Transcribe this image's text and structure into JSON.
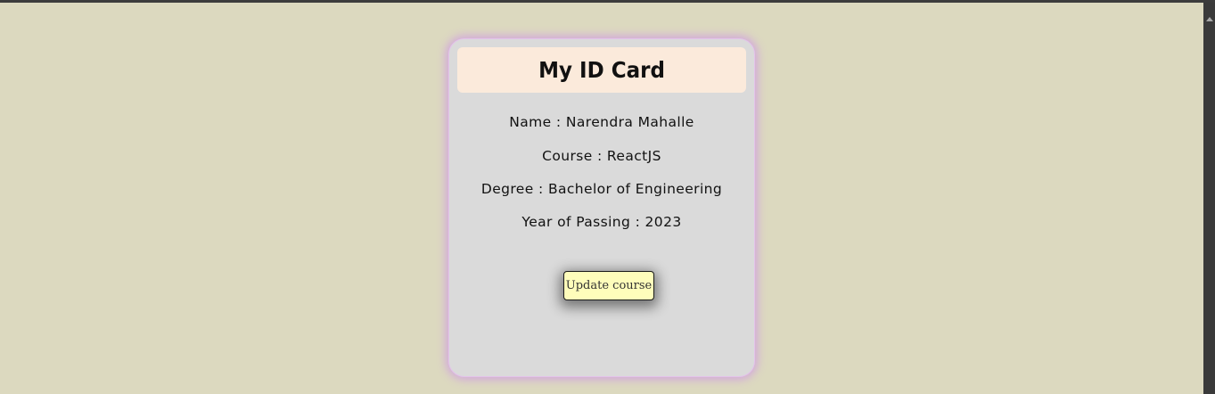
{
  "card": {
    "title": "My ID Card",
    "name_line": "Name : Narendra Mahalle",
    "course_line": "Course : ReactJS",
    "degree_line": "Degree : Bachelor of Engineering",
    "year_line": "Year of Passing : 2023",
    "update_button_label": "Update course"
  },
  "colors": {
    "page_background": "#dcd9bf",
    "card_background": "#dadada",
    "header_background": "#fbeadb",
    "card_glow": "#d2a8dc",
    "button_background": "#fefdbb"
  }
}
